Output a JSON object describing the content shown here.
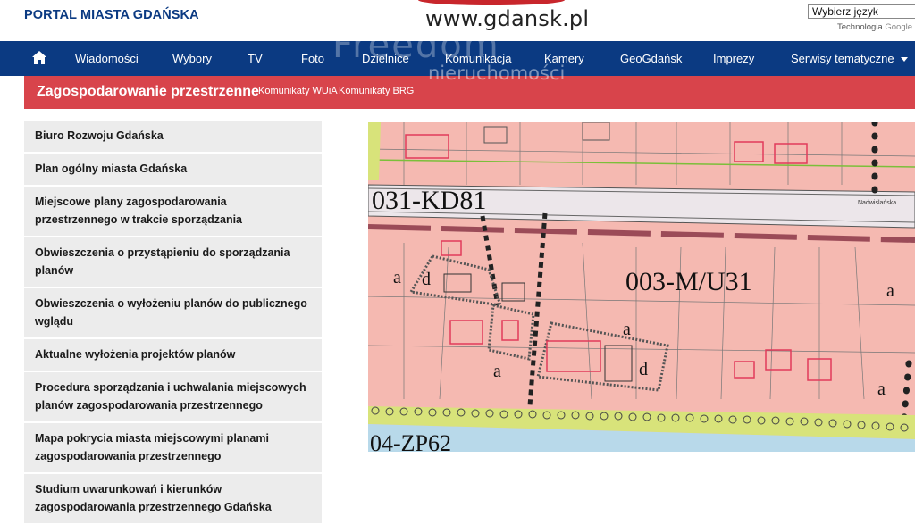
{
  "header": {
    "portal_title": "PORTAL MIASTA GDAŃSKA",
    "logo_text": "www.gdansk.pl",
    "language_select": "Wybierz język",
    "translate_label": "Technologia",
    "translate_brand": "Google"
  },
  "nav": {
    "items": [
      "Wiadomości",
      "Wybory",
      "TV",
      "Foto",
      "Dzielnice",
      "Komunikacja",
      "Kamery",
      "GeoGdańsk",
      "Imprezy",
      "Serwisy tematyczne"
    ]
  },
  "subheader": {
    "title": "Zagospodarowanie przestrzenne",
    "links": [
      "Komunikaty WUiA",
      "Komunikaty BRG"
    ]
  },
  "watermark": {
    "line1": "Freedom",
    "line2": "nieruchomości"
  },
  "sidebar": {
    "items": [
      "Biuro Rozwoju Gdańska",
      "Plan ogólny miasta Gdańska",
      "Miejscowe plany zagospodarowania przestrzennego w trakcie sporządzania",
      "Obwieszczenia o przystąpieniu do sporządzania planów",
      "Obwieszczenia o wyłożeniu planów do publicznego wglądu",
      "Aktualne wyłożenia projektów planów",
      "Procedura sporządzania i uchwalania miejscowych planów zagospodarowania przestrzennego",
      "Mapa pokrycia miasta miejscowymi planami zagospodarowania przestrzennego",
      "Studium uwarunkowań i kierunków zagospodarowania przestrzennego Gdańska"
    ]
  },
  "map": {
    "labels": {
      "road": "031-KD81",
      "zone": "003-M/U31",
      "green": "04-ZP62",
      "street": "Nadwiślańska",
      "a": "a",
      "d": "d"
    },
    "colors": {
      "zone_fill": "#f5b9b1",
      "road_fill": "#ece6ea",
      "water": "#b8d9ea",
      "green_strip": "#d8e37a",
      "building": "#e23b5a"
    }
  }
}
